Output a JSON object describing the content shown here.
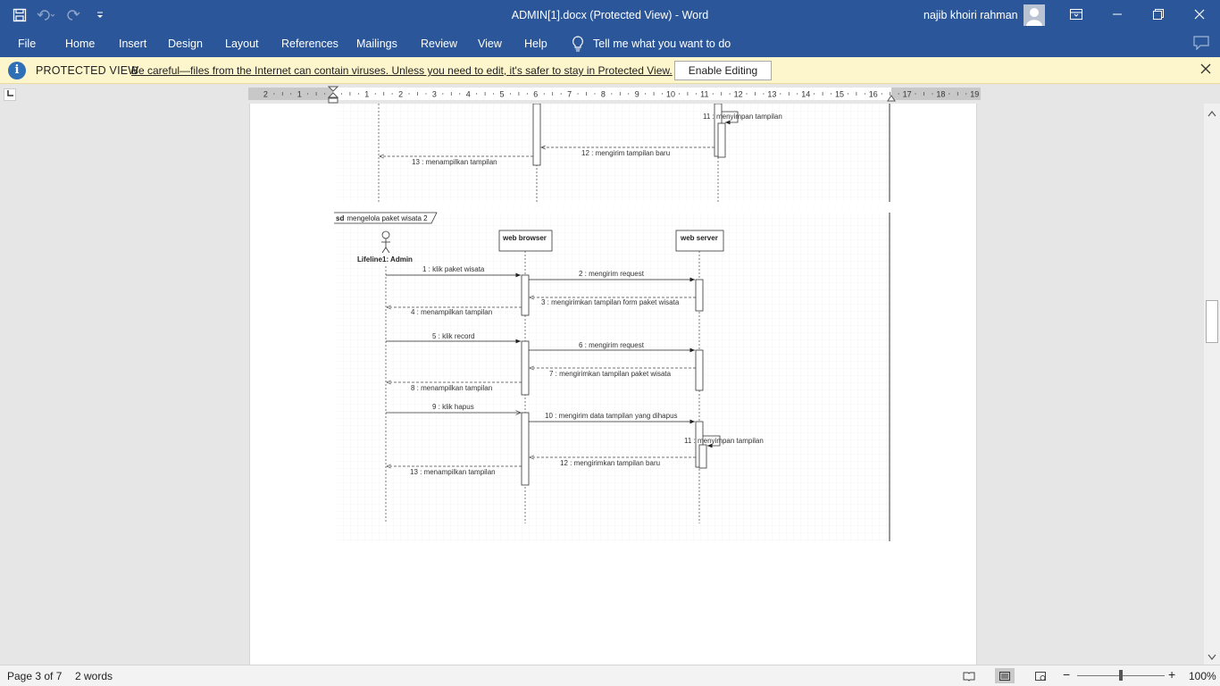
{
  "window": {
    "title": "ADMIN[1].docx (Protected View)  -  Word",
    "user": "najib khoiri rahman"
  },
  "ribbon": {
    "tabs": [
      "File",
      "Home",
      "Insert",
      "Design",
      "Layout",
      "References",
      "Mailings",
      "Review",
      "View",
      "Help"
    ],
    "tell_me": "Tell me what you want to do"
  },
  "protected_view": {
    "title": "PROTECTED VIEW",
    "message": "Be careful—files from the Internet can contain viruses. Unless you need to edit, it's safer to stay in Protected View.",
    "button": "Enable Editing"
  },
  "ruler": {
    "labels": [
      "2",
      "1",
      "",
      "1",
      "2",
      "3",
      "4",
      "5",
      "6",
      "7",
      "8",
      "9",
      "10",
      "11",
      "12",
      "13",
      "14",
      "15",
      "16",
      "17",
      "18",
      "19"
    ]
  },
  "diagram_top": {
    "labels": [
      "11 : menyimpan tampilan",
      "12 : mengirim tampilan baru",
      "13 : menampilkan tampilan"
    ]
  },
  "diagram": {
    "frame_keyword": "sd",
    "frame_title": "mengelola paket wisata 2",
    "actor": "Lifeline1: Admin",
    "lifelines": [
      "web browser",
      "web server"
    ],
    "messages": [
      "1 : klik paket wisata",
      "2 : mengirim request",
      "3 : mengirimkan tampilan form paket wisata",
      "4 : menampilkan tampilan",
      "5 : klik record",
      "6 : mengirim request",
      "7 : mengirimkan tampilan paket wisata",
      "8 : menampilkan tampilan",
      "9 : klik hapus",
      "10 : mengirim data tampilan yang dihapus",
      "11 : menyimpan tampilan",
      "12 : mengirimkan tampilan baru",
      "13 : menampilkan tampilan"
    ]
  },
  "status": {
    "page": "Page 3 of 7",
    "words": "2 words",
    "zoom": "100%"
  },
  "colors": {
    "ribbon": "#2b579a",
    "protected_bar": "#fdf6cc"
  }
}
